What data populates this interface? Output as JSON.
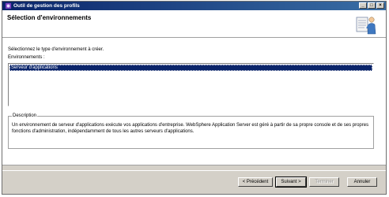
{
  "window": {
    "title": "Outil de gestion des profils",
    "controls": {
      "minimize": "_",
      "maximize": "□",
      "close": "×"
    }
  },
  "header": {
    "title": "Sélection d'environnements",
    "icon": "wizard-person-icon"
  },
  "content": {
    "instruction": "Sélectionnez le type d'environnement à créer.",
    "environments_label": "Environnements :",
    "environments": [
      "Serveur d'applications"
    ],
    "selected_environment": "Serveur d'applications",
    "description_legend": "Description",
    "description_text": "Un environnement de serveur d'applications exécute vos applications d'entreprise.  WebSphere Application Server est géré à partir de sa propre console et de ses propres fonctions d'administration, indépendamment de tous les autres serveurs d'applications."
  },
  "buttons": {
    "back": "< Précédent",
    "next": "Suivant >",
    "finish": "Terminer",
    "cancel": "Annuler"
  },
  "colors": {
    "titlebar": "#0a246a",
    "selection": "#0a246a",
    "dialog_bg": "#d4d0c8"
  }
}
